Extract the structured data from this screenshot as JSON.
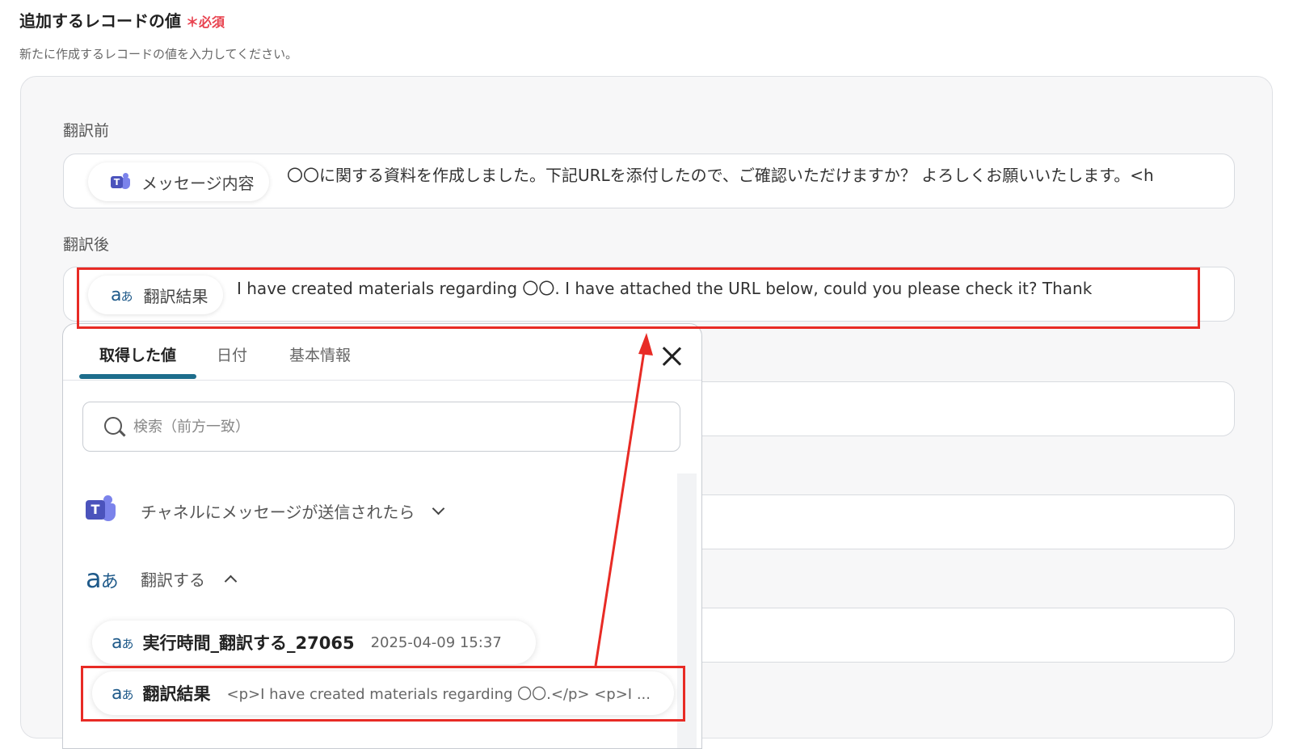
{
  "section": {
    "title": "追加するレコードの値",
    "required_mark": "＊必須",
    "description": "新たに作成するレコードの値を入力してください。"
  },
  "fields": [
    {
      "label": "翻訳前",
      "chip_icon": "teams-icon",
      "chip_label": "メッセージ内容",
      "value": "〇〇に関する資料を作成しました。下記URLを添付したので、ご確認いただけますか？ よろしくお願いいたします。<h"
    },
    {
      "label": "翻訳後",
      "chip_icon": "translate-icon",
      "chip_label": "翻訳結果",
      "value": "I have created materials regarding 〇〇.  I have attached the URL below, could you please check it?  Thank"
    }
  ],
  "popup": {
    "tabs": [
      "取得した値",
      "日付",
      "基本情報"
    ],
    "active_tab": 0,
    "search_placeholder": "検索（前方一致）",
    "groups": [
      {
        "icon": "teams-icon",
        "label": "チャネルにメッセージが送信されたら",
        "expanded": false
      },
      {
        "icon": "translate-icon",
        "label": "翻訳する",
        "expanded": true
      }
    ],
    "items": [
      {
        "icon": "translate-icon",
        "name": "実行時間_翻訳する_27065",
        "value": "2025-04-09 15:37"
      },
      {
        "icon": "translate-icon",
        "name": "翻訳結果",
        "value": "<p>I have created materials regarding 〇〇.</p> <p>I ..."
      }
    ]
  },
  "icon_glyphs": {
    "teams": "T",
    "translate_a": "a",
    "translate_j": "あ"
  },
  "colors": {
    "annotation_red": "#e82b25",
    "tab_underline": "#1d6d8c",
    "required": "#e8414e"
  }
}
